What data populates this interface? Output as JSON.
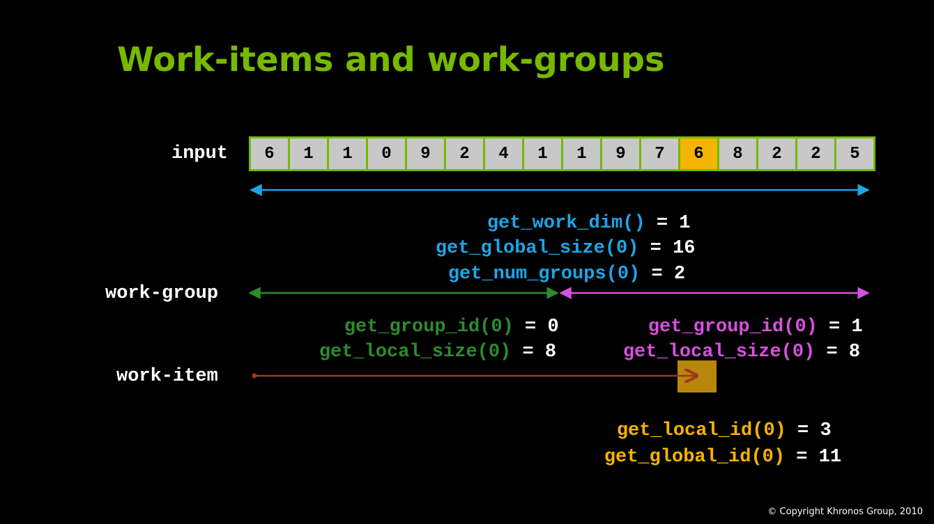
{
  "title": "Work-items and work-groups",
  "labels": {
    "input": "input",
    "work_group": "work-group",
    "work_item": "work-item"
  },
  "input_values": [
    "6",
    "1",
    "1",
    "0",
    "9",
    "2",
    "4",
    "1",
    "1",
    "9",
    "7",
    "6",
    "8",
    "2",
    "2",
    "5"
  ],
  "highlighted_index": 11,
  "global_info": [
    {
      "func": "get_work_dim()",
      "eq": " = ",
      "value": "1"
    },
    {
      "func": "get_global_size(0)",
      "eq": " = ",
      "value": "16"
    },
    {
      "func": "get_num_groups(0)",
      "eq": " = ",
      "value": "2"
    }
  ],
  "group0": [
    {
      "func": "get_group_id(0)",
      "eq": " = ",
      "value": "0"
    },
    {
      "func": "get_local_size(0)",
      "eq": " = ",
      "value": "8"
    }
  ],
  "group1": [
    {
      "func": "get_group_id(0)",
      "eq": " = ",
      "value": "1"
    },
    {
      "func": "get_local_size(0)",
      "eq": " = ",
      "value": "8"
    }
  ],
  "item_info": [
    {
      "func": "get_local_id(0)",
      "eq": " = ",
      "value": "3"
    },
    {
      "func": "get_global_id(0)",
      "eq": " = ",
      "value": "11"
    }
  ],
  "copyright": "© Copyright Khronos Group, 2010",
  "colors": {
    "title": "#76b900",
    "array_border": "#76b900",
    "cell": "#c8c8c8",
    "cell_highlight": "#f5b400",
    "global_arrow": "#1ea5e6",
    "group0_arrow": "#2e8b2e",
    "group1_arrow": "#d94fe0",
    "item_arrow": "#a0381c",
    "item_box": "#b8860b",
    "item_text": "#f5b400"
  }
}
